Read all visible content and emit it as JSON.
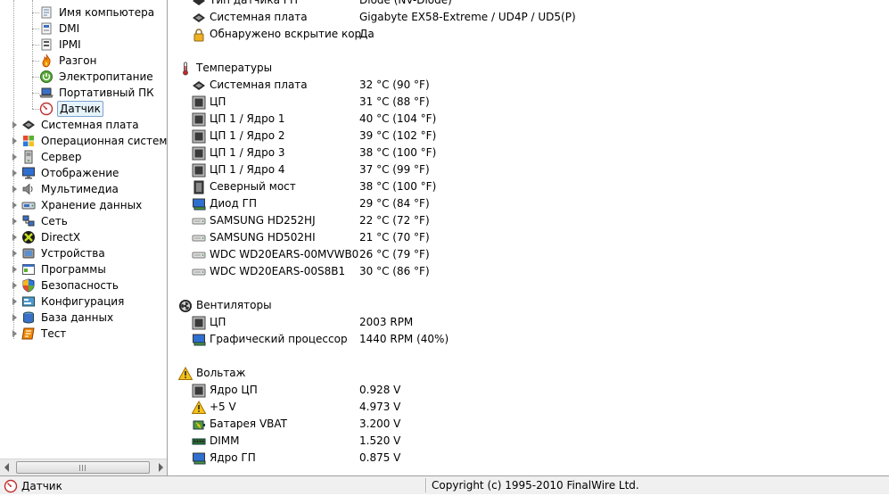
{
  "tree": {
    "items": [
      {
        "label": "Имя компьютера",
        "icon": "computer-name-icon",
        "level": 2
      },
      {
        "label": "DMI",
        "icon": "dmi-icon",
        "level": 2
      },
      {
        "label": "IPMI",
        "icon": "ipmi-icon",
        "level": 2
      },
      {
        "label": "Разгон",
        "icon": "overclock-flame-icon",
        "level": 2
      },
      {
        "label": "Электропитание",
        "icon": "power-icon",
        "level": 2
      },
      {
        "label": "Портативный ПК",
        "icon": "portable-pc-icon",
        "level": 2
      },
      {
        "label": "Датчик",
        "icon": "sensor-gauge-icon",
        "level": 2,
        "selected": true
      },
      {
        "label": "Системная плата",
        "icon": "motherboard-icon",
        "level": 1
      },
      {
        "label": "Операционная система",
        "icon": "windows-icon",
        "level": 1
      },
      {
        "label": "Сервер",
        "icon": "server-icon",
        "level": 1
      },
      {
        "label": "Отображение",
        "icon": "display-icon",
        "level": 1
      },
      {
        "label": "Мультимедиа",
        "icon": "speaker-icon",
        "level": 1
      },
      {
        "label": "Хранение данных",
        "icon": "storage-icon",
        "level": 1
      },
      {
        "label": "Сеть",
        "icon": "network-icon",
        "level": 1
      },
      {
        "label": "DirectX",
        "icon": "directx-icon",
        "level": 1
      },
      {
        "label": "Устройства",
        "icon": "devices-icon",
        "level": 1
      },
      {
        "label": "Программы",
        "icon": "programs-icon",
        "level": 1
      },
      {
        "label": "Безопасность",
        "icon": "security-shield-icon",
        "level": 1
      },
      {
        "label": "Конфигурация",
        "icon": "config-icon",
        "level": 1
      },
      {
        "label": "База данных",
        "icon": "database-icon",
        "level": 1
      },
      {
        "label": "Тест",
        "icon": "test-icon",
        "level": 1
      }
    ]
  },
  "content": {
    "top_rows": [
      {
        "field": "Тип датчика ГП",
        "value": "Diode  (NV-Diode)",
        "icon": "sensor-icon"
      },
      {
        "field": "Системная плата",
        "value": "Gigabyte EX58-Extreme / UD4P / UD5(P)",
        "icon": "motherboard-icon"
      },
      {
        "field": "Обнаружено вскрытие кор...",
        "value": "Да",
        "icon": "lock-icon"
      }
    ],
    "temperatures": {
      "title": "Температуры",
      "icon": "thermometer-icon",
      "rows": [
        {
          "field": "Системная плата",
          "value": "32 °C  (90 °F)",
          "icon": "motherboard-icon"
        },
        {
          "field": "ЦП",
          "value": "31 °C  (88 °F)",
          "icon": "cpu-icon"
        },
        {
          "field": "ЦП 1 / Ядро 1",
          "value": "40 °C  (104 °F)",
          "icon": "cpu-icon"
        },
        {
          "field": "ЦП 1 / Ядро 2",
          "value": "39 °C  (102 °F)",
          "icon": "cpu-icon"
        },
        {
          "field": "ЦП 1 / Ядро 3",
          "value": "38 °C  (100 °F)",
          "icon": "cpu-icon"
        },
        {
          "field": "ЦП 1 / Ядро 4",
          "value": "37 °C  (99 °F)",
          "icon": "cpu-icon"
        },
        {
          "field": "Северный мост",
          "value": "38 °C  (100 °F)",
          "icon": "northbridge-icon"
        },
        {
          "field": "Диод ГП",
          "value": "29 °C  (84 °F)",
          "icon": "gpu-icon"
        },
        {
          "field": "SAMSUNG HD252HJ",
          "value": "22 °C  (72 °F)",
          "icon": "hdd-icon"
        },
        {
          "field": "SAMSUNG HD502HI",
          "value": "21 °C  (70 °F)",
          "icon": "hdd-icon"
        },
        {
          "field": "WDC WD20EARS-00MVWB0",
          "value": "26 °C  (79 °F)",
          "icon": "hdd-icon"
        },
        {
          "field": "WDC WD20EARS-00S8B1",
          "value": "30 °C  (86 °F)",
          "icon": "hdd-icon"
        }
      ]
    },
    "fans": {
      "title": "Вентиляторы",
      "icon": "fan-icon",
      "rows": [
        {
          "field": "ЦП",
          "value": "2003 RPM",
          "icon": "cpu-icon"
        },
        {
          "field": "Графический процессор",
          "value": "1440 RPM  (40%)",
          "icon": "gpu-icon"
        }
      ]
    },
    "voltage": {
      "title": "Вольтаж",
      "icon": "warning-icon",
      "rows": [
        {
          "field": "Ядро ЦП",
          "value": "0.928 V",
          "icon": "cpu-icon"
        },
        {
          "field": "+5 V",
          "value": "4.973 V",
          "icon": "warning-icon"
        },
        {
          "field": "Батарея VBAT",
          "value": "3.200 V",
          "icon": "battery-icon"
        },
        {
          "field": "DIMM",
          "value": "1.520 V",
          "icon": "memory-icon"
        },
        {
          "field": "Ядро ГП",
          "value": "0.875 V",
          "icon": "gpu-icon"
        }
      ]
    }
  },
  "statusbar": {
    "left": "Датчик",
    "right": "Copyright (c) 1995-2010 FinalWire Ltd."
  }
}
